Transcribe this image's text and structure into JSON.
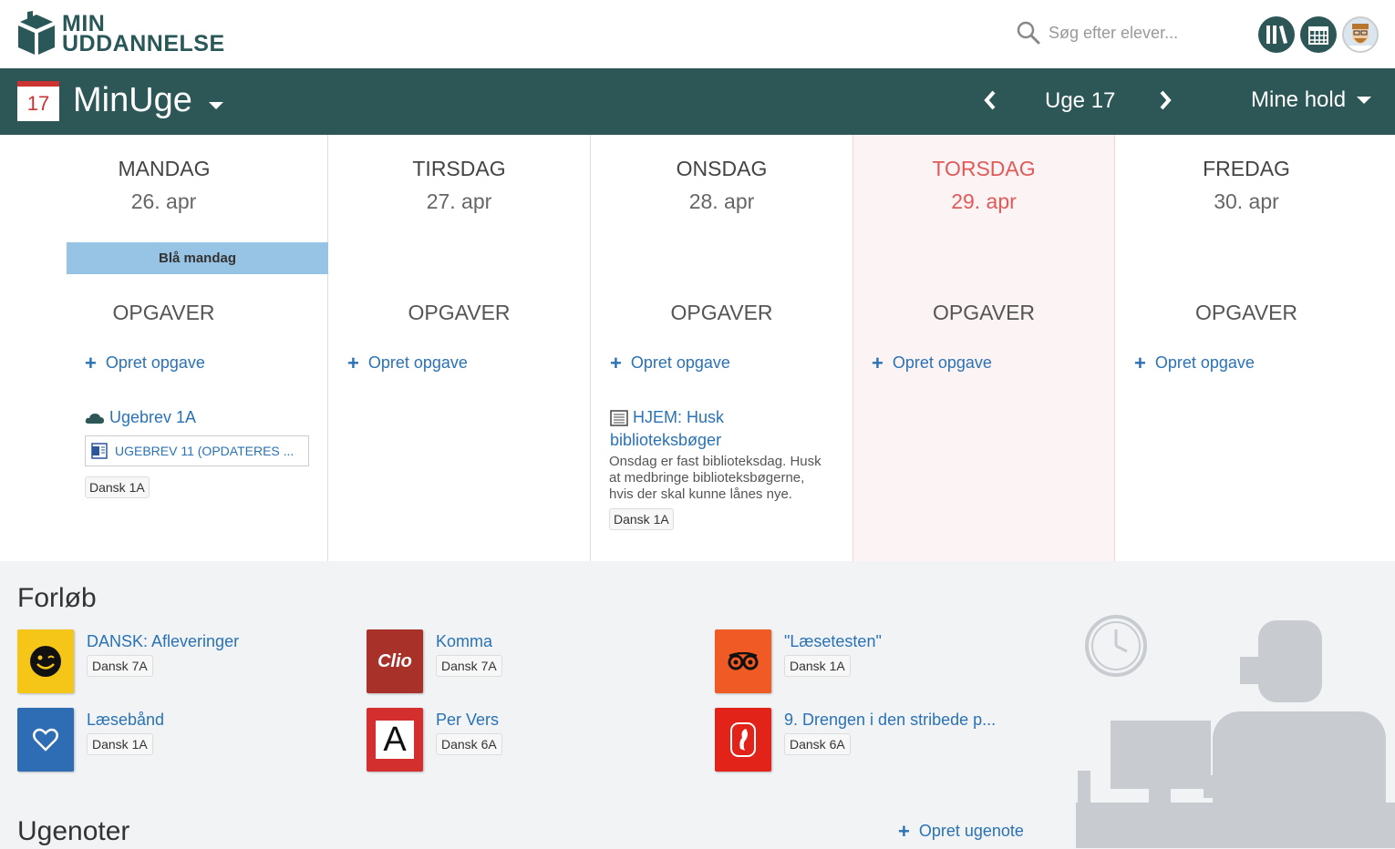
{
  "header": {
    "logo_line1": "MIN",
    "logo_line2": "UDDANNELSE",
    "search_placeholder": "Søg efter elever..."
  },
  "weekbar": {
    "calendar_day": "17",
    "app_title": "MinUge",
    "week_label": "Uge 17",
    "teams_label": "Mine hold"
  },
  "days": [
    {
      "name": "MANDAG",
      "date": "26. apr",
      "tasks_header": "OPGAVER",
      "create_label": "Opret opgave"
    },
    {
      "name": "TIRSDAG",
      "date": "27. apr",
      "tasks_header": "OPGAVER",
      "create_label": "Opret opgave"
    },
    {
      "name": "ONSDAG",
      "date": "28. apr",
      "tasks_header": "OPGAVER",
      "create_label": "Opret opgave"
    },
    {
      "name": "TORSDAG",
      "date": "29. apr",
      "tasks_header": "OPGAVER",
      "create_label": "Opret opgave"
    },
    {
      "name": "FREDAG",
      "date": "30. apr",
      "tasks_header": "OPGAVER",
      "create_label": "Opret opgave"
    }
  ],
  "monday": {
    "event_label": "Blå mandag",
    "task_title": "Ugebrev 1A",
    "attachment": "UGEBREV 11 (OPDATERES ...",
    "tag": "Dansk 1A"
  },
  "wednesday": {
    "task_title_line1": "HJEM: Husk",
    "task_title_line2": "biblioteksbøger",
    "desc_line1": "Onsdag er fast biblioteksdag. Husk",
    "desc_line2": "at medbringe biblioteksbøgerne,",
    "desc_line3": "hvis der skal kunne lånes nye.",
    "tag": "Dansk 1A"
  },
  "forloeb": {
    "title": "Forløb",
    "courses": [
      {
        "name": "DANSK: Afleveringer",
        "tag": "Dansk 7A",
        "color": "#f5c518"
      },
      {
        "name": "Komma",
        "tag": "Dansk 7A",
        "color": "#a8312a",
        "logo": "Clio"
      },
      {
        "name": "\"Læsetesten\"",
        "tag": "Dansk 1A",
        "color": "#f05a24"
      },
      {
        "name": "Læsebånd",
        "tag": "Dansk 1A",
        "color": "#2e6db4"
      },
      {
        "name": "Per Vers",
        "tag": "Dansk 6A",
        "color": "#d32f2f",
        "logo": "A"
      },
      {
        "name": "9. Drengen i den stribede p...",
        "tag": "Dansk 6A",
        "color": "#e2231a"
      }
    ]
  },
  "ugenoter": {
    "title": "Ugenoter",
    "create_label": "Opret ugenote"
  },
  "colors": {
    "brand_dark": "#2d5656",
    "link_blue": "#2a72b5",
    "today_red": "#e15a5a",
    "event_blue": "#97c3e4"
  }
}
